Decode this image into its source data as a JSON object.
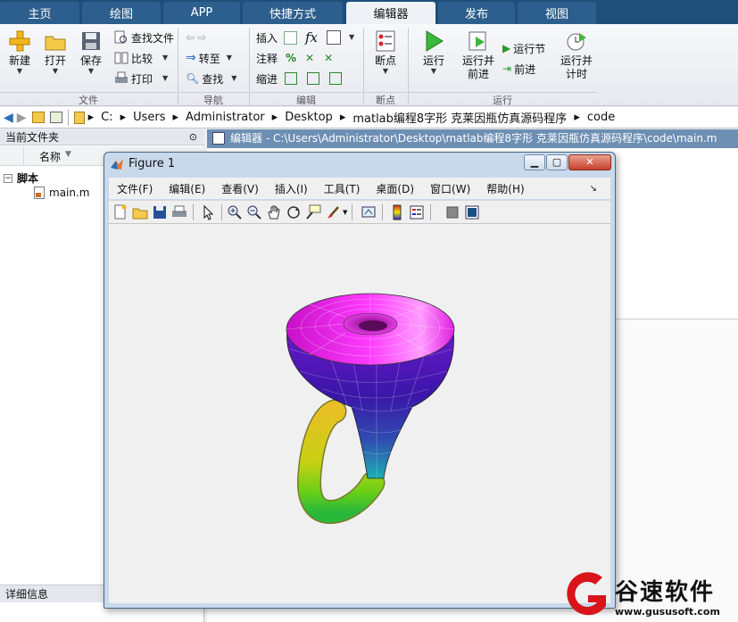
{
  "tabs": [
    {
      "label": "主页"
    },
    {
      "label": "绘图"
    },
    {
      "label": "APP"
    },
    {
      "label": "快捷方式"
    },
    {
      "label": "编辑器"
    },
    {
      "label": "发布"
    },
    {
      "label": "视图"
    }
  ],
  "active_tab_index": 4,
  "ribbon": {
    "file": {
      "group_label": "文件",
      "new": "新建",
      "open": "打开",
      "save": "保存",
      "find_files": "查找文件",
      "compare": "比较",
      "print": "打印"
    },
    "nav": {
      "group_label": "导航",
      "goto": "转至",
      "find": "查找"
    },
    "edit": {
      "group_label": "编辑",
      "insert": "插入",
      "comment": "注释",
      "indent": "缩进",
      "fx": "fx",
      "percent": "%"
    },
    "breakpoints": {
      "group_label": "断点",
      "breakpoints": "断点"
    },
    "run": {
      "group_label": "运行",
      "run": "运行",
      "run_advance_line1": "运行并",
      "run_advance_line2": "前进",
      "run_section": "运行节",
      "advance": "前进",
      "run_time_line1": "运行并",
      "run_time_line2": "计时"
    }
  },
  "address": {
    "crumbs": [
      "C:",
      "Users",
      "Administrator",
      "Desktop",
      "matlab编程8字形 克莱因瓶仿真源码程序",
      "code"
    ]
  },
  "left_panel": {
    "title": "当前文件夹",
    "column_name": "名称",
    "folder": "脚本",
    "file": "main.m",
    "details": "详细信息"
  },
  "editor": {
    "title": "编辑器 - C:\\Users\\Administrator\\Desktop\\matlab编程8字形 克莱因瓶仿真源码程序\\code\\main.m"
  },
  "figure": {
    "title": "Figure 1",
    "menus": [
      "文件(F)",
      "编辑(E)",
      "查看(V)",
      "插入(I)",
      "工具(T)",
      "桌面(D)",
      "窗口(W)",
      "帮助(H)"
    ]
  },
  "watermark": {
    "name": "谷速软件",
    "url": "www.gususoft.com"
  },
  "colors": {
    "tab_bar": "#1e4e7a",
    "tab": "#2c5f8d",
    "editor_title": "#6d8fb3",
    "watermark_red": "#d9141b"
  }
}
